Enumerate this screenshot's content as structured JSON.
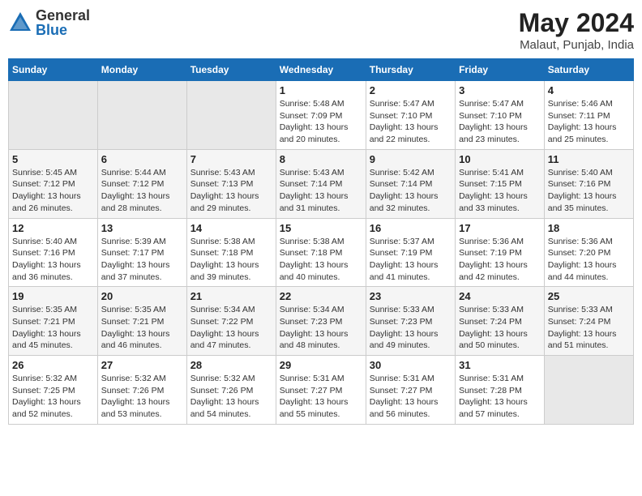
{
  "header": {
    "logo_general": "General",
    "logo_blue": "Blue",
    "month_year": "May 2024",
    "location": "Malaut, Punjab, India"
  },
  "days_of_week": [
    "Sunday",
    "Monday",
    "Tuesday",
    "Wednesday",
    "Thursday",
    "Friday",
    "Saturday"
  ],
  "weeks": [
    [
      {
        "day": "",
        "detail": ""
      },
      {
        "day": "",
        "detail": ""
      },
      {
        "day": "",
        "detail": ""
      },
      {
        "day": "1",
        "detail": "Sunrise: 5:48 AM\nSunset: 7:09 PM\nDaylight: 13 hours\nand 20 minutes."
      },
      {
        "day": "2",
        "detail": "Sunrise: 5:47 AM\nSunset: 7:10 PM\nDaylight: 13 hours\nand 22 minutes."
      },
      {
        "day": "3",
        "detail": "Sunrise: 5:47 AM\nSunset: 7:10 PM\nDaylight: 13 hours\nand 23 minutes."
      },
      {
        "day": "4",
        "detail": "Sunrise: 5:46 AM\nSunset: 7:11 PM\nDaylight: 13 hours\nand 25 minutes."
      }
    ],
    [
      {
        "day": "5",
        "detail": "Sunrise: 5:45 AM\nSunset: 7:12 PM\nDaylight: 13 hours\nand 26 minutes."
      },
      {
        "day": "6",
        "detail": "Sunrise: 5:44 AM\nSunset: 7:12 PM\nDaylight: 13 hours\nand 28 minutes."
      },
      {
        "day": "7",
        "detail": "Sunrise: 5:43 AM\nSunset: 7:13 PM\nDaylight: 13 hours\nand 29 minutes."
      },
      {
        "day": "8",
        "detail": "Sunrise: 5:43 AM\nSunset: 7:14 PM\nDaylight: 13 hours\nand 31 minutes."
      },
      {
        "day": "9",
        "detail": "Sunrise: 5:42 AM\nSunset: 7:14 PM\nDaylight: 13 hours\nand 32 minutes."
      },
      {
        "day": "10",
        "detail": "Sunrise: 5:41 AM\nSunset: 7:15 PM\nDaylight: 13 hours\nand 33 minutes."
      },
      {
        "day": "11",
        "detail": "Sunrise: 5:40 AM\nSunset: 7:16 PM\nDaylight: 13 hours\nand 35 minutes."
      }
    ],
    [
      {
        "day": "12",
        "detail": "Sunrise: 5:40 AM\nSunset: 7:16 PM\nDaylight: 13 hours\nand 36 minutes."
      },
      {
        "day": "13",
        "detail": "Sunrise: 5:39 AM\nSunset: 7:17 PM\nDaylight: 13 hours\nand 37 minutes."
      },
      {
        "day": "14",
        "detail": "Sunrise: 5:38 AM\nSunset: 7:18 PM\nDaylight: 13 hours\nand 39 minutes."
      },
      {
        "day": "15",
        "detail": "Sunrise: 5:38 AM\nSunset: 7:18 PM\nDaylight: 13 hours\nand 40 minutes."
      },
      {
        "day": "16",
        "detail": "Sunrise: 5:37 AM\nSunset: 7:19 PM\nDaylight: 13 hours\nand 41 minutes."
      },
      {
        "day": "17",
        "detail": "Sunrise: 5:36 AM\nSunset: 7:19 PM\nDaylight: 13 hours\nand 42 minutes."
      },
      {
        "day": "18",
        "detail": "Sunrise: 5:36 AM\nSunset: 7:20 PM\nDaylight: 13 hours\nand 44 minutes."
      }
    ],
    [
      {
        "day": "19",
        "detail": "Sunrise: 5:35 AM\nSunset: 7:21 PM\nDaylight: 13 hours\nand 45 minutes."
      },
      {
        "day": "20",
        "detail": "Sunrise: 5:35 AM\nSunset: 7:21 PM\nDaylight: 13 hours\nand 46 minutes."
      },
      {
        "day": "21",
        "detail": "Sunrise: 5:34 AM\nSunset: 7:22 PM\nDaylight: 13 hours\nand 47 minutes."
      },
      {
        "day": "22",
        "detail": "Sunrise: 5:34 AM\nSunset: 7:23 PM\nDaylight: 13 hours\nand 48 minutes."
      },
      {
        "day": "23",
        "detail": "Sunrise: 5:33 AM\nSunset: 7:23 PM\nDaylight: 13 hours\nand 49 minutes."
      },
      {
        "day": "24",
        "detail": "Sunrise: 5:33 AM\nSunset: 7:24 PM\nDaylight: 13 hours\nand 50 minutes."
      },
      {
        "day": "25",
        "detail": "Sunrise: 5:33 AM\nSunset: 7:24 PM\nDaylight: 13 hours\nand 51 minutes."
      }
    ],
    [
      {
        "day": "26",
        "detail": "Sunrise: 5:32 AM\nSunset: 7:25 PM\nDaylight: 13 hours\nand 52 minutes."
      },
      {
        "day": "27",
        "detail": "Sunrise: 5:32 AM\nSunset: 7:26 PM\nDaylight: 13 hours\nand 53 minutes."
      },
      {
        "day": "28",
        "detail": "Sunrise: 5:32 AM\nSunset: 7:26 PM\nDaylight: 13 hours\nand 54 minutes."
      },
      {
        "day": "29",
        "detail": "Sunrise: 5:31 AM\nSunset: 7:27 PM\nDaylight: 13 hours\nand 55 minutes."
      },
      {
        "day": "30",
        "detail": "Sunrise: 5:31 AM\nSunset: 7:27 PM\nDaylight: 13 hours\nand 56 minutes."
      },
      {
        "day": "31",
        "detail": "Sunrise: 5:31 AM\nSunset: 7:28 PM\nDaylight: 13 hours\nand 57 minutes."
      },
      {
        "day": "",
        "detail": ""
      }
    ]
  ]
}
